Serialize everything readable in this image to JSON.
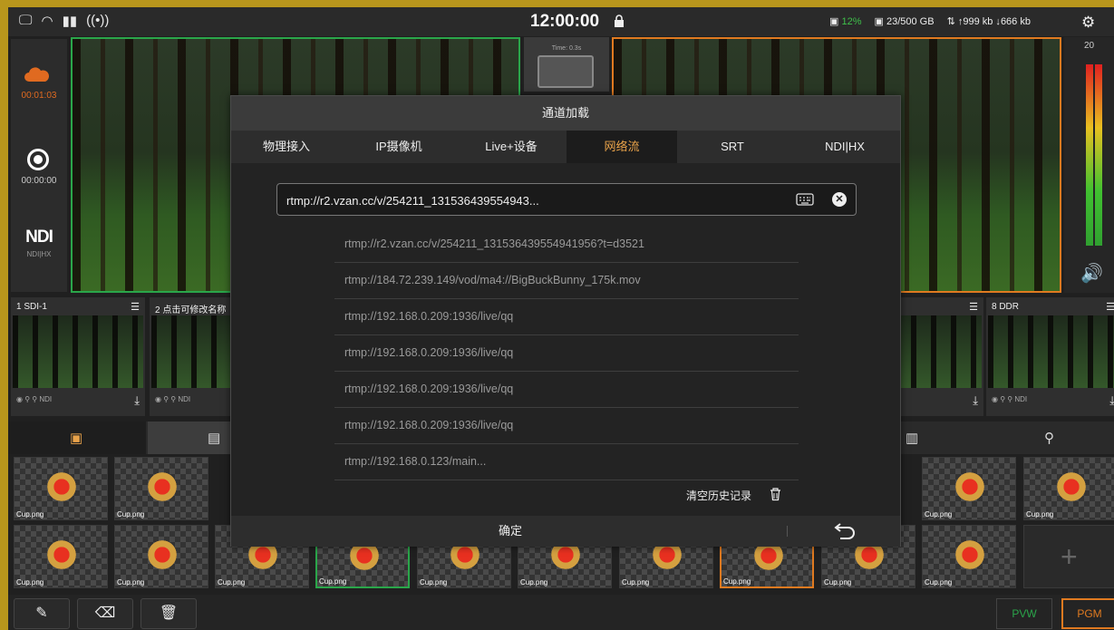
{
  "topbar": {
    "time": "12:00:00",
    "cpu": "12%",
    "storage": "23/500 GB",
    "upload": "999 kb",
    "download": "666 kb"
  },
  "left": {
    "stream_time": "00:01:03",
    "record_time": "00:00:00",
    "ndi_logo": "NDI",
    "ndi_sub": "NDI|HX"
  },
  "mid": {
    "time_label": "Time: 0.3s"
  },
  "meter": {
    "top_value": "20"
  },
  "sources": [
    {
      "label": "1  SDI-1"
    },
    {
      "label": "2  点击可修改名称"
    },
    {
      "label": "8  DDR"
    }
  ],
  "grid": {
    "item_name": "Cup.png"
  },
  "dialog": {
    "title": "通道加载",
    "tabs": [
      "物理接入",
      "IP摄像机",
      "Live+设备",
      "网络流",
      "SRT",
      "NDI|HX"
    ],
    "url_value": "rtmp://r2.vzan.cc/v/254211_131536439554943...",
    "history": [
      "rtmp://r2.vzan.cc/v/254211_131536439554941956?t=d3521",
      "rtmp://184.72.239.149/vod/ma4://BigBuckBunny_175k.mov",
      "rtmp://192.168.0.209:1936/live/qq",
      "rtmp://192.168.0.209:1936/live/qq",
      "rtmp://192.168.0.209:1936/live/qq",
      "rtmp://192.168.0.209:1936/live/qq",
      "rtmp://192.168.0.123/main..."
    ],
    "clear_history": "清空历史记录",
    "ok_label": "确定"
  },
  "bottom": {
    "pvw": "PVW",
    "pgm": "PGM"
  },
  "colors": {
    "pvw_border": "#2aa64a",
    "pgm_border": "#e07a20",
    "active_tab": "#e8a24a"
  }
}
